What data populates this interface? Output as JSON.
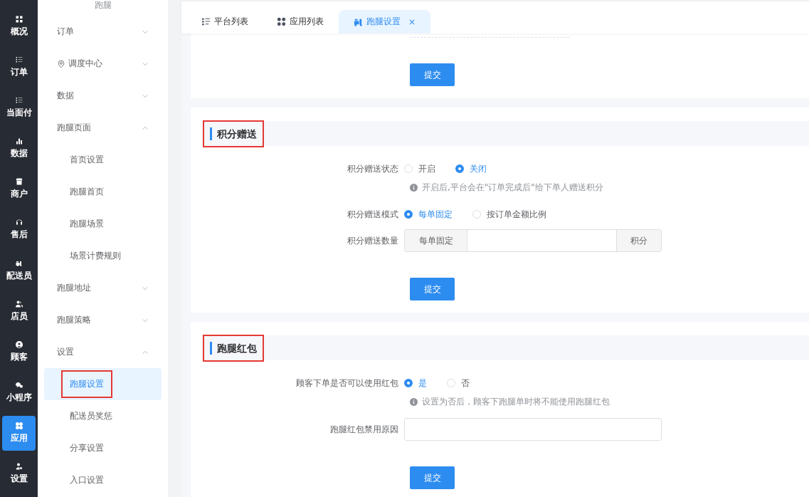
{
  "nav": [
    {
      "label": "概况",
      "selected": false
    },
    {
      "label": "订单",
      "selected": false
    },
    {
      "label": "当面付",
      "selected": false
    },
    {
      "label": "数据",
      "selected": false
    },
    {
      "label": "商户",
      "selected": false
    },
    {
      "label": "售后",
      "selected": false
    },
    {
      "label": "配送员",
      "selected": false
    },
    {
      "label": "店员",
      "selected": false
    },
    {
      "label": "顾客",
      "selected": false
    },
    {
      "label": "小程序",
      "selected": false
    },
    {
      "label": "应用",
      "selected": true
    },
    {
      "label": "设置",
      "selected": false
    }
  ],
  "submenu": {
    "title": "跑腿",
    "groups": [
      {
        "label": "订单",
        "expanded": false
      },
      {
        "label": "调度中心",
        "kind": "location",
        "expanded": false
      },
      {
        "label": "数据",
        "expanded": false
      },
      {
        "label": "跑腿页面",
        "expanded": true,
        "children": [
          {
            "label": "首页设置",
            "selected": false,
            "annotated": false
          },
          {
            "label": "跑腿首页",
            "selected": false,
            "annotated": false
          },
          {
            "label": "跑腿场景",
            "selected": false,
            "annotated": false
          },
          {
            "label": "场景计费规则",
            "selected": false,
            "annotated": false
          }
        ]
      },
      {
        "label": "跑腿地址",
        "expanded": false
      },
      {
        "label": "跑腿策略",
        "expanded": false
      },
      {
        "label": "设置",
        "expanded": true,
        "children": [
          {
            "label": "跑腿设置",
            "selected": true,
            "annotated": true
          },
          {
            "label": "配送员奖惩",
            "selected": false,
            "annotated": false
          },
          {
            "label": "分享设置",
            "selected": false,
            "annotated": false
          },
          {
            "label": "入口设置",
            "selected": false,
            "annotated": false
          }
        ]
      }
    ]
  },
  "tabs": [
    {
      "label": "平台列表",
      "kind": "list",
      "selected": false,
      "closable": false
    },
    {
      "label": "应用列表",
      "kind": "grid",
      "selected": false,
      "closable": false
    },
    {
      "label": "跑腿设置",
      "kind": "scooter",
      "selected": true,
      "closable": true,
      "close": "×"
    }
  ],
  "top_card": {
    "submit": "提交"
  },
  "sections": [
    {
      "title": "积分赠送",
      "annotated": true,
      "rows": [
        {
          "kind": "radio",
          "label": "积分赠送状态",
          "options": [
            {
              "label": "开启",
              "selected": false
            },
            {
              "label": "关闭",
              "selected": true
            }
          ],
          "hint": "开启后,平台会在\"订单完成后\"给下单人赠送积分"
        },
        {
          "kind": "radio",
          "label": "积分赠送模式",
          "options": [
            {
              "label": "每单固定",
              "selected": true
            },
            {
              "label": "按订单金额比例",
              "selected": false
            }
          ]
        },
        {
          "kind": "input-group",
          "label": "积分赠送数量",
          "prepend": "每单固定",
          "append": "积分"
        }
      ],
      "submit": "提交"
    },
    {
      "title": "跑腿红包",
      "annotated": true,
      "rows": [
        {
          "kind": "radio",
          "label": "顾客下单是否可以使用红包",
          "options": [
            {
              "label": "是",
              "selected": true
            },
            {
              "label": "否",
              "selected": false
            }
          ],
          "hint": "设置为否后，顾客下跑腿单时将不能使用跑腿红包"
        },
        {
          "kind": "input",
          "label": "跑腿红包禁用原因"
        }
      ],
      "submit": "提交"
    }
  ]
}
